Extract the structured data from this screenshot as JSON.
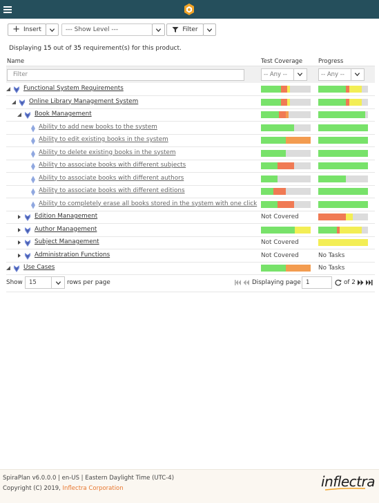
{
  "header": {
    "menu_icon": "hamburger-icon",
    "logo_icon": "spira-logo-icon"
  },
  "toolbar": {
    "insert_label": "Insert",
    "show_level_value": "--- Show Level ---",
    "filter_label": "Filter"
  },
  "summary": {
    "prefix": "Displaying",
    "shown": "15",
    "middle": "out of",
    "total": "35",
    "suffix": "requirement(s) for this product."
  },
  "columns": {
    "name": "Name",
    "coverage": "Test Coverage",
    "progress": "Progress"
  },
  "filters": {
    "name_placeholder": "Filter",
    "coverage_value": "-- Any --",
    "progress_value": "-- Any --"
  },
  "colors": {
    "green": "#78e26a",
    "orange": "#f07a54",
    "lightorange": "#f39c50",
    "yellow": "#f3ee55",
    "gray": "#dcdcdc",
    "icon_blue": "#6f86d6",
    "leaf_blue": "#90a8e0"
  },
  "rows": [
    {
      "name": "Functional System Requirements",
      "level": 0,
      "type": "folder",
      "expander": "collapse",
      "coverage": [
        [
          0.4,
          "green"
        ],
        [
          0.13,
          "orange"
        ],
        [
          0.06,
          "yellow"
        ],
        [
          0.41,
          "gray"
        ]
      ],
      "progress": [
        [
          0.56,
          "green"
        ],
        [
          0.06,
          "orange"
        ],
        [
          0.26,
          "yellow"
        ],
        [
          0.12,
          "gray"
        ]
      ]
    },
    {
      "name": "Online Library Management System",
      "level": 1,
      "type": "folder",
      "expander": "collapse",
      "coverage": [
        [
          0.4,
          "green"
        ],
        [
          0.13,
          "orange"
        ],
        [
          0.06,
          "yellow"
        ],
        [
          0.41,
          "gray"
        ]
      ],
      "progress": [
        [
          0.56,
          "green"
        ],
        [
          0.06,
          "orange"
        ],
        [
          0.26,
          "yellow"
        ],
        [
          0.12,
          "gray"
        ]
      ]
    },
    {
      "name": "Book Management",
      "level": 2,
      "type": "folder",
      "expander": "collapse",
      "coverage": [
        [
          0.36,
          "green"
        ],
        [
          0.14,
          "orange"
        ],
        [
          0.06,
          "lightorange"
        ],
        [
          0.44,
          "gray"
        ]
      ],
      "progress": [
        [
          0.95,
          "green"
        ],
        [
          0.05,
          "gray"
        ]
      ]
    },
    {
      "name": "Ability to add new books to the system",
      "level": 3,
      "type": "leaf",
      "coverage": [
        [
          0.67,
          "green"
        ],
        [
          0.33,
          "gray"
        ]
      ],
      "progress": [
        [
          1.0,
          "green"
        ]
      ]
    },
    {
      "name": "Ability to edit existing books in the system",
      "level": 3,
      "type": "leaf",
      "coverage": [
        [
          0.5,
          "green"
        ],
        [
          0.5,
          "lightorange"
        ]
      ],
      "progress": [
        [
          1.0,
          "green"
        ]
      ]
    },
    {
      "name": "Ability to delete existing books in the system",
      "level": 3,
      "type": "leaf",
      "coverage": [
        [
          0.5,
          "green"
        ],
        [
          0.5,
          "gray"
        ]
      ],
      "progress": [
        [
          1.0,
          "green"
        ]
      ]
    },
    {
      "name": "Ability to associate books with different subjects",
      "level": 3,
      "type": "leaf",
      "coverage": [
        [
          0.33,
          "green"
        ],
        [
          0.33,
          "orange"
        ],
        [
          0.34,
          "gray"
        ]
      ],
      "progress": [
        [
          1.0,
          "green"
        ]
      ]
    },
    {
      "name": "Ability to associate books with different authors",
      "level": 3,
      "type": "leaf",
      "coverage": [
        [
          0.33,
          "green"
        ],
        [
          0.67,
          "gray"
        ]
      ],
      "progress": [
        [
          0.55,
          "green"
        ],
        [
          0.45,
          "gray"
        ]
      ]
    },
    {
      "name": "Ability to associate books with different editions",
      "level": 3,
      "type": "leaf",
      "coverage": [
        [
          0.25,
          "green"
        ],
        [
          0.25,
          "orange"
        ],
        [
          0.5,
          "gray"
        ]
      ],
      "progress": [
        [
          1.0,
          "green"
        ]
      ]
    },
    {
      "name": "Ability to completely erase all books stored in the system with one click",
      "level": 3,
      "type": "leaf",
      "coverage": [
        [
          0.33,
          "green"
        ],
        [
          0.33,
          "orange"
        ],
        [
          0.34,
          "gray"
        ]
      ],
      "progress": [
        [
          1.0,
          "green"
        ]
      ]
    },
    {
      "name": "Edition Management",
      "level": 2,
      "type": "folder",
      "expander": "expand",
      "coverage_text": "Not Covered",
      "progress": [
        [
          0.55,
          "orange"
        ],
        [
          0.15,
          "yellow"
        ],
        [
          0.3,
          "gray"
        ]
      ]
    },
    {
      "name": "Author Management",
      "level": 2,
      "type": "folder",
      "expander": "expand",
      "coverage": [
        [
          0.68,
          "green"
        ],
        [
          0.32,
          "yellow"
        ]
      ],
      "progress": [
        [
          0.37,
          "green"
        ],
        [
          0.06,
          "orange"
        ],
        [
          0.45,
          "yellow"
        ],
        [
          0.12,
          "gray"
        ]
      ]
    },
    {
      "name": "Subject Management",
      "level": 2,
      "type": "folder",
      "expander": "expand",
      "coverage_text": "Not Covered",
      "progress": [
        [
          1.0,
          "yellow"
        ]
      ]
    },
    {
      "name": "Administration Functions",
      "level": 2,
      "type": "folder",
      "expander": "expand",
      "coverage_text": "Not Covered",
      "progress_text": "No Tasks"
    },
    {
      "name": "Use Cases",
      "level": 0,
      "type": "folder",
      "expander": "collapse",
      "coverage": [
        [
          0.5,
          "green"
        ],
        [
          0.5,
          "lightorange"
        ]
      ],
      "progress_text": "No Tasks"
    }
  ],
  "pager": {
    "show_label": "Show",
    "rows_value": "15",
    "rows_suffix": "rows per page",
    "displaying_label": "Displaying page",
    "current_page": "1",
    "of_label": "of 2"
  },
  "footer": {
    "version_line": "SpiraPlan v6.0.0.0 | en-US | Eastern Daylight Time (UTC-4)",
    "copyright_prefix": "Copyright (C) 2019,",
    "company_link": "Inflectra Corporation",
    "brand": "inflectra"
  }
}
